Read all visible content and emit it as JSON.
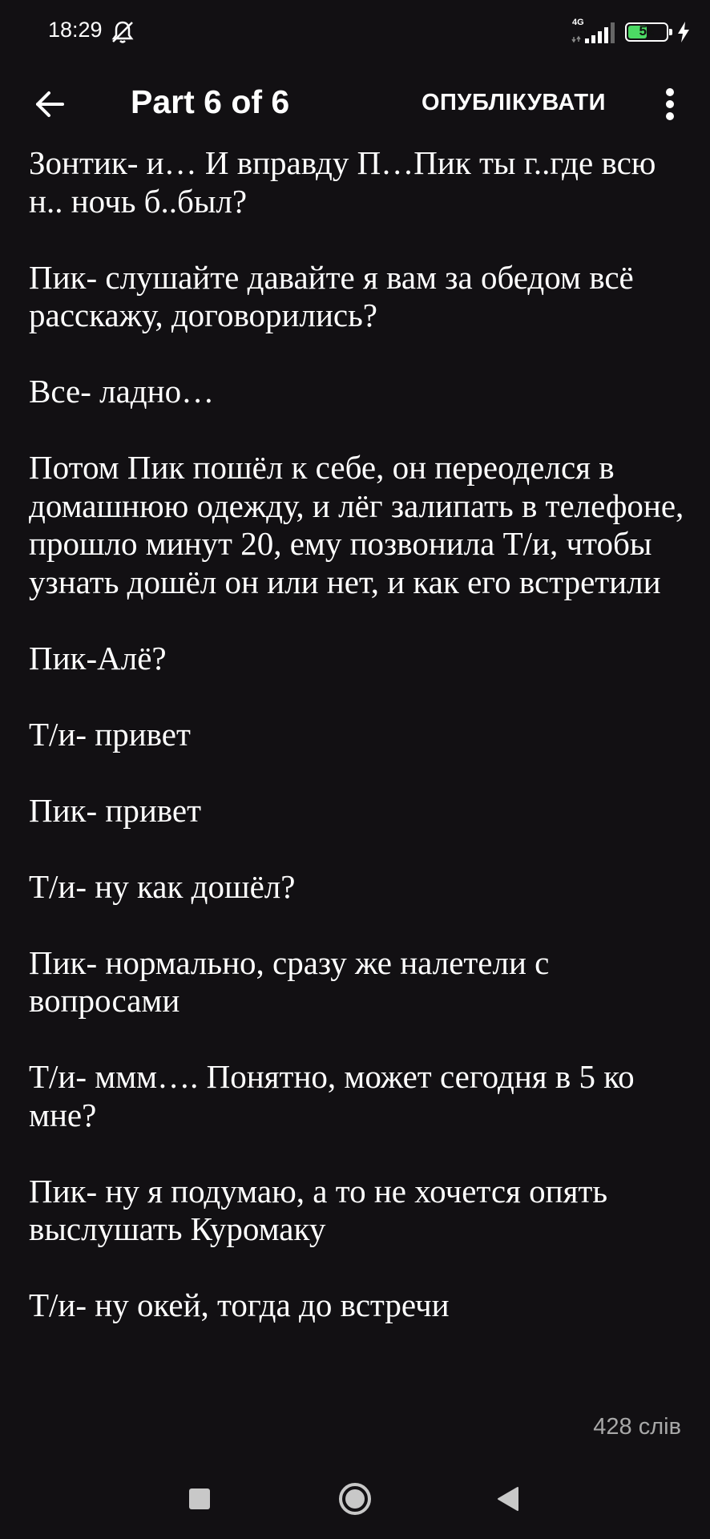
{
  "status_bar": {
    "time": "18:29",
    "network_label": "4G",
    "battery_level": "52",
    "battery_fraction": 0.52,
    "icons": [
      "mute-notifications-icon",
      "signal-icon",
      "battery-icon",
      "charging-icon"
    ]
  },
  "header": {
    "back_icon": "arrow-left-icon",
    "title": "Part 6 of 6",
    "publish_label": "ОПУБЛІКУВАТИ",
    "more_icon": "more-vert-icon"
  },
  "story": {
    "paragraphs": [
      "Зонтик- и… И вправду П…Пик ты г..где всю н.. ночь б..был?",
      "Пик- слушайте давайте я вам за обедом всё расскажу, договорились?",
      "Все- ладно…",
      "Потом Пик пошёл к себе, он переоделся в домашнюю одежду, и лёг залипать в телефоне, прошло минут 20, ему позвонила Т/и, чтобы узнать дошёл он или нет, и как его встретили",
      "Пик-Алё?",
      "Т/и- привет",
      "Пик- привет",
      "Т/и- ну как дошёл?",
      "Пик- нормально, сразу же налетели с вопросами",
      "Т/и- ммм…. Понятно, может сегодня в 5 ко мне?",
      "Пик- ну я подумаю, а то не хочется опять выслушать Куромаку",
      "Т/и- ну окей, тогда до встречи"
    ]
  },
  "footer": {
    "word_count": "428 слів"
  },
  "nav_bar": {
    "icons": [
      "recents-square-icon",
      "home-circle-icon",
      "back-triangle-icon"
    ]
  },
  "colors": {
    "background": "#121013",
    "text": "#ffffff",
    "muted": "#a8a8a8",
    "battery_fill": "#4cd964"
  }
}
